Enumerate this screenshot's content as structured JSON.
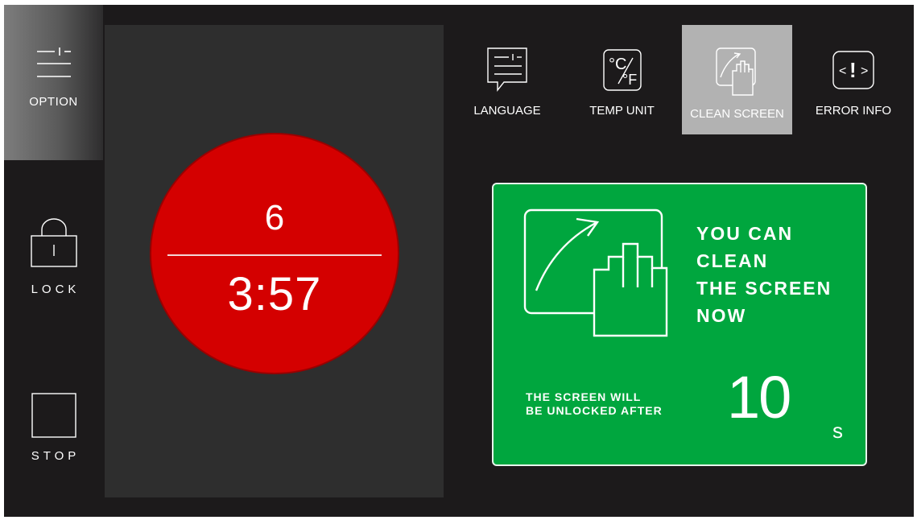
{
  "sidebar": {
    "option": {
      "label": "OPTION",
      "icon": "option-icon"
    },
    "lock": {
      "label": "LOCK",
      "icon": "lock-icon"
    },
    "stop": {
      "label": "STOP",
      "icon": "stop-icon"
    }
  },
  "dial": {
    "top_value": "6",
    "bottom_value": "3:57",
    "color": "#d40000"
  },
  "menu": {
    "items": [
      {
        "label": "LANGUAGE",
        "icon": "language-icon"
      },
      {
        "label": "TEMP UNIT",
        "icon": "temp-unit-icon"
      },
      {
        "label": "CLEAN SCREEN",
        "icon": "clean-screen-icon",
        "selected": true
      },
      {
        "label": "ERROR INFO",
        "icon": "error-info-icon"
      }
    ]
  },
  "notice": {
    "message": "YOU CAN\nCLEAN\nTHE SCREEN\nNOW",
    "sub": "THE SCREEN WILL\nBE UNLOCKED AFTER",
    "count": "10",
    "unit": "s",
    "color": "#00a63e"
  }
}
